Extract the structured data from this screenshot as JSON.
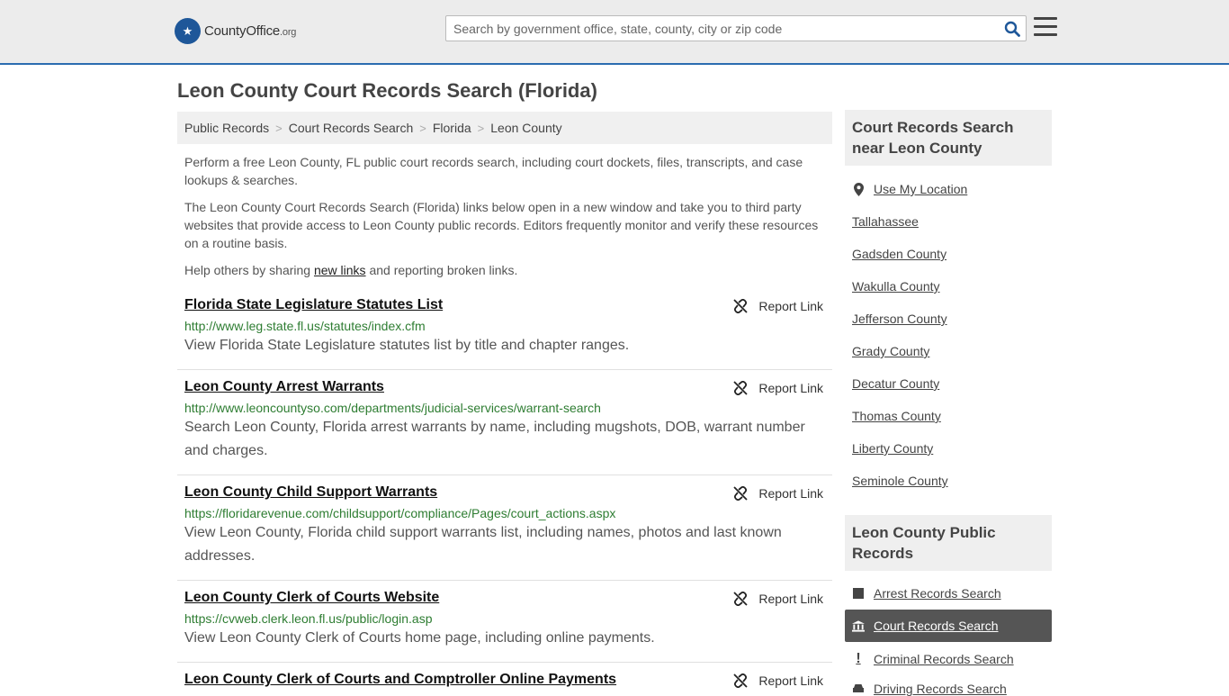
{
  "header": {
    "logo_text": "CountyOffice",
    "logo_tld": ".org",
    "search_placeholder": "Search by government office, state, county, city or zip code"
  },
  "page_title": "Leon County Court Records Search (Florida)",
  "breadcrumb": [
    "Public Records",
    "Court Records Search",
    "Florida",
    "Leon County"
  ],
  "intro": {
    "p1": "Perform a free Leon County, FL public court records search, including court dockets, files, transcripts, and case lookups & searches.",
    "p2": "The Leon County Court Records Search (Florida) links below open in a new window and take you to third party websites that provide access to Leon County public records. Editors frequently monitor and verify these resources on a routine basis.",
    "p3_before": "Help others by sharing ",
    "p3_link": "new links",
    "p3_after": " and reporting broken links."
  },
  "report_label": "Report Link",
  "results": [
    {
      "title": "Florida State Legislature Statutes List",
      "url": "http://www.leg.state.fl.us/statutes/index.cfm",
      "desc": "View Florida State Legislature statutes list by title and chapter ranges."
    },
    {
      "title": "Leon County Arrest Warrants",
      "url": "http://www.leoncountyso.com/departments/judicial-services/warrant-search",
      "desc": "Search Leon County, Florida arrest warrants by name, including mugshots, DOB, warrant number and charges."
    },
    {
      "title": "Leon County Child Support Warrants",
      "url": "https://floridarevenue.com/childsupport/compliance/Pages/court_actions.aspx",
      "desc": "View Leon County, Florida child support warrants list, including names, photos and last known addresses."
    },
    {
      "title": "Leon County Clerk of Courts Website",
      "url": "https://cvweb.clerk.leon.fl.us/public/login.asp",
      "desc": "View Leon County Clerk of Courts home page, including online payments."
    },
    {
      "title": "Leon County Clerk of Courts and Comptroller Online Payments",
      "url": "",
      "desc": ""
    }
  ],
  "sidebar": {
    "near_title": "Court Records Search near Leon County",
    "use_location": "Use My Location",
    "near_links": [
      "Tallahassee",
      "Gadsden County",
      "Wakulla County",
      "Jefferson County",
      "Grady County",
      "Decatur County",
      "Thomas County",
      "Liberty County",
      "Seminole County"
    ],
    "public_title": "Leon County Public Records",
    "public_links": [
      {
        "label": "Arrest Records Search",
        "icon": "square-icon"
      },
      {
        "label": "Court Records Search",
        "icon": "courthouse-icon",
        "active": true
      },
      {
        "label": "Criminal Records Search",
        "icon": "exclamation-icon"
      },
      {
        "label": "Driving Records Search",
        "icon": "car-icon"
      }
    ]
  },
  "colors": {
    "accent": "#2b6cb0",
    "url_green": "#2e7d32",
    "active_bg": "#555555"
  }
}
